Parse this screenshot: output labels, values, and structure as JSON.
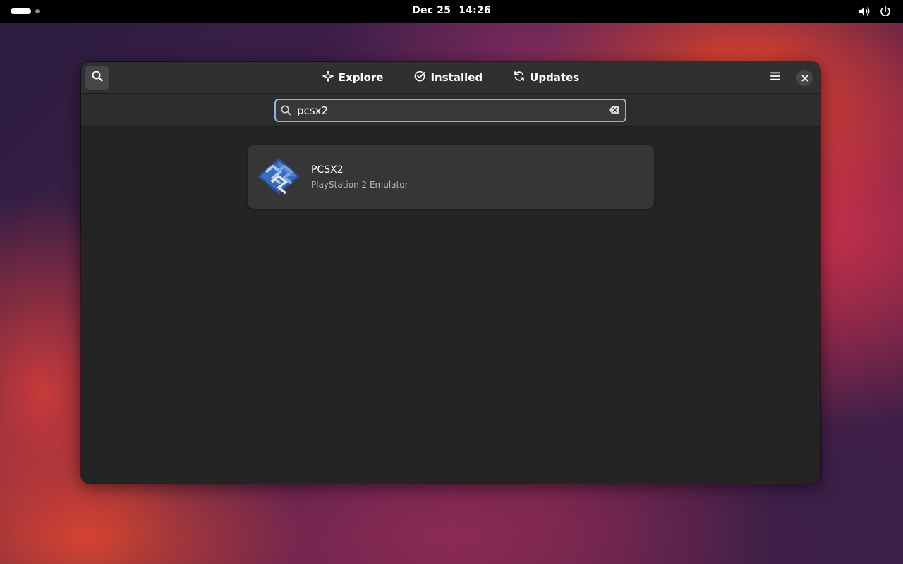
{
  "topbar": {
    "date": "Dec 25",
    "time": "14:26"
  },
  "window": {
    "tabs": [
      {
        "label": "Explore",
        "icon": "sparkle-icon"
      },
      {
        "label": "Installed",
        "icon": "check-circle-icon"
      },
      {
        "label": "Updates",
        "icon": "refresh-icon"
      }
    ],
    "search": {
      "value": "pcsx2",
      "placeholder": ""
    },
    "results": [
      {
        "name": "PCSX2",
        "summary": "PlayStation 2 Emulator"
      }
    ]
  },
  "colors": {
    "topbar": "#000000",
    "headerbar": "#303030",
    "window_bg": "#242424",
    "card_bg": "#363636",
    "focus_ring": "#8fb4de"
  }
}
